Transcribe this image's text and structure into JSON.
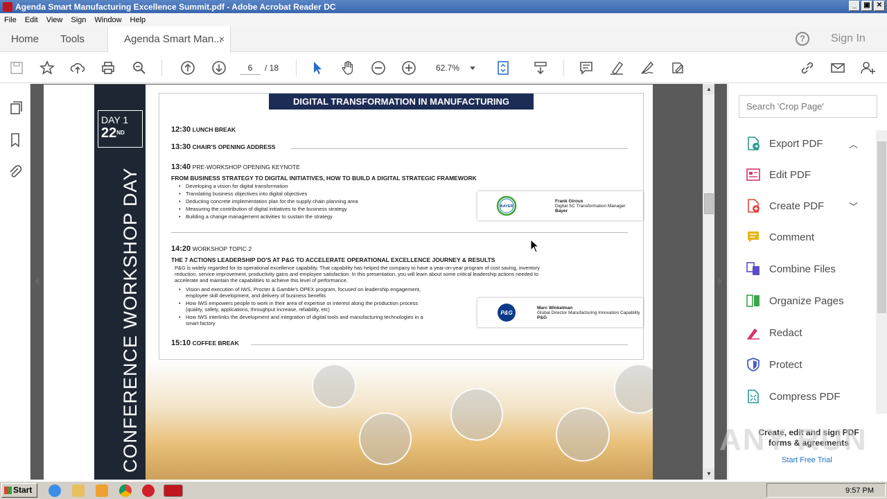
{
  "window": {
    "title": "Agenda Smart Manufacturing Excellence Summit.pdf - Adobe Acrobat Reader DC",
    "min": "_",
    "max": "▣",
    "close": "✕"
  },
  "menu": [
    "File",
    "Edit",
    "View",
    "Sign",
    "Window",
    "Help"
  ],
  "tabs": {
    "home": "Home",
    "tools": "Tools",
    "doc": "Agenda Smart Man...",
    "close": "×"
  },
  "header": {
    "help": "?",
    "signin": "Sign In"
  },
  "toolbar": {
    "page_current": "6",
    "page_total": "/ 18",
    "zoom": "62.7%"
  },
  "document": {
    "day_label": "DAY 1",
    "day_num": "22",
    "day_suffix": "ND",
    "vertical_title": "CONFERENCE WORKSHOP DAY",
    "banner": "DIGITAL TRANSFORMATION IN MANUFACTURING",
    "items": {
      "lunch_time": "12:30",
      "lunch_label": "LUNCH BREAK",
      "chair_time": "13:30",
      "chair_label": "CHAIR'S OPENING ADDRESS",
      "keynote_time": "13:40",
      "keynote_label": "PRE-WORKSHOP OPENING KEYNOTE",
      "keynote_title": "FROM BUSINESS STRATEGY TO DIGITAL INITIATIVES, HOW TO BUILD A DIGITAL STRATEGIC FRAMEWORK",
      "keynote_bullets": [
        "Developing a vision for digital transformation",
        "Translating business objectives into digital objectives",
        "Deducting concrete implementation plan for the supply chain planning area",
        "Measuring the contribution of digital initiatives to the business strategy",
        "Building a change management activities to sustain the strategy"
      ],
      "topic_time": "14:20",
      "topic_label": "WORKSHOP TOPIC 2",
      "topic_title": "THE 7 ACTIONS LEADERSHIP DO'S AT P&G TO ACCELERATE OPERATIONAL EXCELLENCE JOURNEY & RESULTS",
      "topic_para": [
        "P&G is widely regarded for its operational excellence capability. That capability has helped the company to have a year-on-year program of cost saving, inventory",
        "reduction, service improvement, productivity gains and employee satisfaction. In this presentation, you will learn about some critical leadership actions needed to",
        "accelerate and maintain the capabilities to achieve this level of performance."
      ],
      "topic_bullets": [
        [
          "Vision and execution of IWS, Procter & Gamble's OPEX program, focused on leadership engagement,",
          "employee skill development, and delivery of business benefits"
        ],
        [
          "How IWS empowers people to work in their area of expertise or interest along the production process",
          "(quality, safety, applications, throughput increase, reliability, etc)"
        ],
        [
          "How IWS interlinks the development and integration of digital tools and manufacturing technologies in a",
          "smart factory"
        ]
      ],
      "coffee_time": "15:10",
      "coffee_label": "COFFEE BREAK"
    },
    "speakers": [
      {
        "logo": "BAYER",
        "name": "Frank Giroux",
        "role": "Digital SC Transformation Manager",
        "company": "Bayer"
      },
      {
        "logo": "P&G",
        "name": "Marc Winkelman",
        "role": "Global Director Manufacturing Innovation Capability",
        "company": "P&G"
      }
    ]
  },
  "right_panel": {
    "search_placeholder": "Search 'Crop Page'",
    "tools": [
      {
        "label": "Export PDF",
        "color": "#2b9a8f"
      },
      {
        "label": "Edit PDF",
        "color": "#d6336c"
      },
      {
        "label": "Create PDF",
        "color": "#e0473f"
      },
      {
        "label": "Comment",
        "color": "#e5b616"
      },
      {
        "label": "Combine Files",
        "color": "#5b4fc7"
      },
      {
        "label": "Organize Pages",
        "color": "#3fa34d"
      },
      {
        "label": "Redact",
        "color": "#d6336c"
      },
      {
        "label": "Protect",
        "color": "#4a5dc4"
      },
      {
        "label": "Compress PDF",
        "color": "#2b9a8f"
      }
    ],
    "promo": "Create, edit and sign PDF forms & agreements",
    "trial": "Start Free Trial"
  },
  "watermark": "ANY RUN",
  "taskbar": {
    "start": "Start",
    "clock": "9:57 PM"
  }
}
